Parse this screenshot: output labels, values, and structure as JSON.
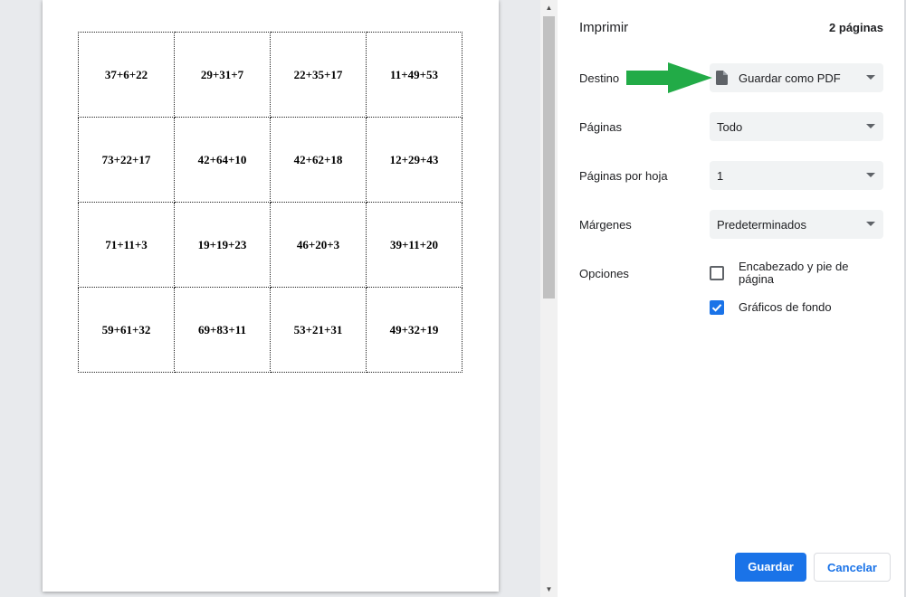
{
  "preview": {
    "cells": [
      [
        "37+6+22",
        "29+31+7",
        "22+35+17",
        "11+49+53"
      ],
      [
        "73+22+17",
        "42+64+10",
        "42+62+18",
        "12+29+43"
      ],
      [
        "71+11+3",
        "19+19+23",
        "46+20+3",
        "39+11+20"
      ],
      [
        "59+61+32",
        "69+83+11",
        "53+21+31",
        "49+32+19"
      ]
    ]
  },
  "panel": {
    "title": "Imprimir",
    "pages_count": "2 páginas",
    "destination": {
      "label": "Destino",
      "value": "Guardar como PDF",
      "icon": "document-icon"
    },
    "pages": {
      "label": "Páginas",
      "value": "Todo"
    },
    "pages_per_sheet": {
      "label": "Páginas por hoja",
      "value": "1"
    },
    "margins": {
      "label": "Márgenes",
      "value": "Predeterminados"
    },
    "options": {
      "label": "Opciones",
      "header_footer": {
        "label": "Encabezado y pie de página",
        "checked": false
      },
      "background_graphics": {
        "label": "Gráficos de fondo",
        "checked": true
      }
    },
    "buttons": {
      "save": "Guardar",
      "cancel": "Cancelar"
    }
  },
  "colors": {
    "accent": "#1a73e8",
    "arrow": "#22ab47"
  }
}
